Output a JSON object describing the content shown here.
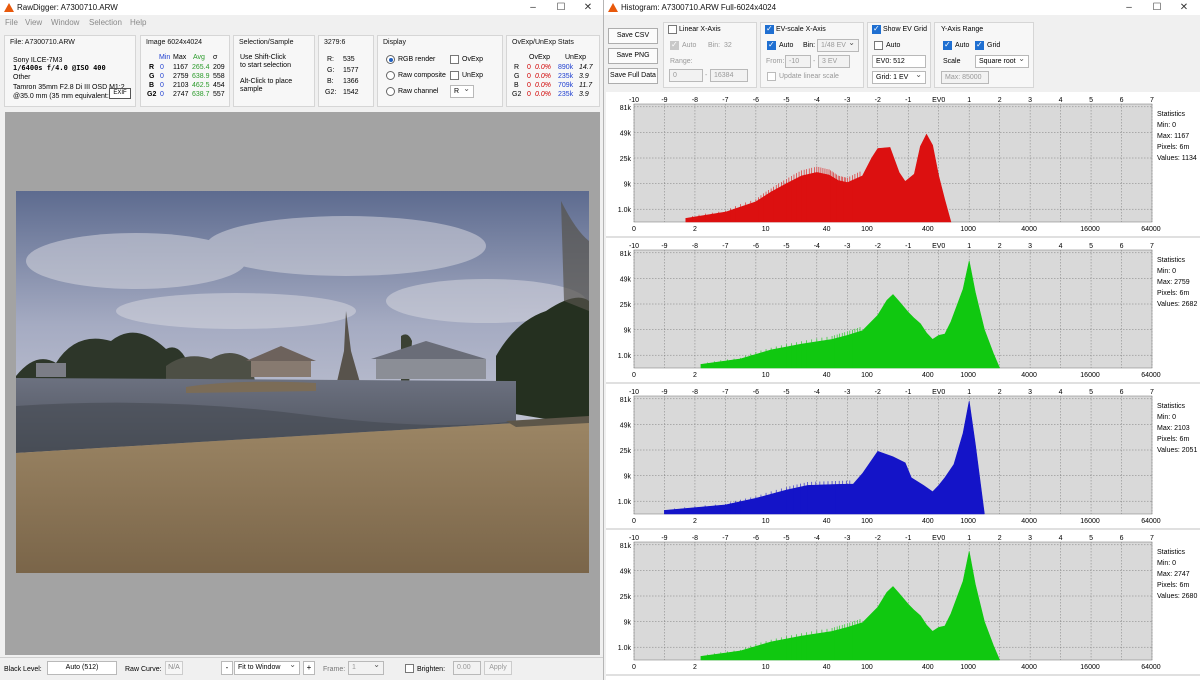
{
  "left": {
    "title": "RawDigger: A7300710.ARW",
    "menu": [
      "File",
      "View",
      "Window",
      "Selection",
      "Help"
    ],
    "file_panel": {
      "title": "File: A7300710.ARW",
      "camera": "Sony ILCE-7M3",
      "exposure": "1/6400s f/4.0 @ISO 400",
      "other": "Other",
      "lens": "Tamron 35mm F2.8 Di III OSD M1:2",
      "focal": "@35.0 mm (35 mm equivalent:",
      "exif_button": "EXIF"
    },
    "image_panel": {
      "title": "Image 6024x4024",
      "headers": [
        "Min",
        "Max",
        "Avg",
        "σ"
      ],
      "rows": [
        {
          "ch": "R",
          "min": "0",
          "max": "1167",
          "avg": "265.4",
          "sd": "209"
        },
        {
          "ch": "G",
          "min": "0",
          "max": "2759",
          "avg": "638.9",
          "sd": "558"
        },
        {
          "ch": "B",
          "min": "0",
          "max": "2103",
          "avg": "462.5",
          "sd": "454"
        },
        {
          "ch": "G2",
          "min": "0",
          "max": "2747",
          "avg": "638.7",
          "sd": "557"
        }
      ]
    },
    "selection_panel": {
      "title": "Selection/Sample",
      "line1": "Use Shift-Click",
      "line2": "to start selection",
      "line3": "Alt-Click to place",
      "line4": "sample"
    },
    "coord_panel": {
      "title": "3279:6",
      "rows": [
        {
          "k": "R:",
          "v": "535"
        },
        {
          "k": "G:",
          "v": "1577"
        },
        {
          "k": "B:",
          "v": "1366"
        },
        {
          "k": "G2:",
          "v": "1542"
        }
      ]
    },
    "display_panel": {
      "title": "Display",
      "rgb_render": "RGB render",
      "raw_composite": "Raw composite",
      "raw_channel": "Raw channel",
      "ovexp": "OvExp",
      "unexp": "UnExp",
      "channel": "R"
    },
    "stats_panel": {
      "title": "OvExp/UnExp Stats",
      "headers": [
        "OvExp",
        "UnExp"
      ],
      "rows": [
        {
          "ch": "R",
          "ov": "0",
          "ovp": "0.0%",
          "un": "890k",
          "unp": "14.7"
        },
        {
          "ch": "G",
          "ov": "0",
          "ovp": "0.0%",
          "un": "235k",
          "unp": "3.9"
        },
        {
          "ch": "B",
          "ov": "0",
          "ovp": "0.0%",
          "un": "709k",
          "unp": "11.7"
        },
        {
          "ch": "G2",
          "ov": "0",
          "ovp": "0.0%",
          "un": "235k",
          "unp": "3.9"
        }
      ]
    },
    "statusbar": {
      "black_level_label": "Black Level:",
      "black_level_value": "Auto (512)",
      "raw_curve_label": "Raw Curve:",
      "raw_curve_value": "N/A",
      "minus": "-",
      "zoom": "Fit to Window",
      "plus": "+",
      "frame_label": "Frame:",
      "frame_value": "1",
      "brighten_label": "Brighten:",
      "brighten_value": "0.00",
      "apply": "Apply"
    }
  },
  "right": {
    "title": "Histogram: A7300710.ARW Full-6024x4024",
    "buttons": {
      "save_csv": "Save CSV",
      "save_png": "Save PNG",
      "save_full": "Save Full Data"
    },
    "linear": {
      "title": "Linear X-Axis",
      "auto": "Auto",
      "bin_label": "Bin:",
      "bin_value": "32",
      "range_label": "Range:",
      "range_from": "0",
      "range_to": "16384"
    },
    "evscale": {
      "title": "EV-scale X-Axis",
      "auto": "Auto",
      "bin_label": "Bin:",
      "bin_value": "1/48 EV",
      "from_label": "From:",
      "from_value": "-10",
      "to_value": "3 EV",
      "update": "Update linear scale"
    },
    "evgrid": {
      "title": "Show EV Grid",
      "auto": "Auto",
      "ev0": "EV0: 512",
      "grid": "Grid: 1 EV"
    },
    "yaxis": {
      "title": "Y-Axis Range",
      "auto": "Auto",
      "grid": "Grid",
      "scale_label": "Scale",
      "scale_value": "Square root",
      "max": "Max: 85000"
    },
    "colors": {
      "R": "#dc1010",
      "G": "#10c810",
      "B": "#1414c8",
      "G2": "#10c810"
    },
    "axis": {
      "ev_ticks": [
        "-10",
        "-9",
        "-8",
        "-7",
        "-6",
        "-5",
        "-4",
        "-3",
        "-2",
        "-1",
        "EV0",
        "1",
        "2",
        "3",
        "4",
        "5",
        "6",
        "7"
      ],
      "lin_ticks": [
        "0",
        "2",
        "10",
        "40",
        "100",
        "400",
        "1000",
        "4000",
        "16000",
        "64000"
      ],
      "y_ticks": [
        "81k",
        "49k",
        "25k",
        "9k",
        "1.0k"
      ]
    }
  },
  "chart_data": [
    {
      "type": "area",
      "channel": "R",
      "x_scale": "EV",
      "xlim": [
        -10,
        7
      ],
      "y_scale": "sqrt",
      "ylim": [
        0,
        85000
      ],
      "grid": true,
      "x": [
        -8.3,
        -7,
        -6,
        -5.5,
        -5,
        -4.5,
        -4,
        -3.6,
        -3.3,
        -3,
        -2.5,
        -2.2,
        -2,
        -1.6,
        -1.3,
        -1.1,
        -0.8,
        -0.6,
        -0.4,
        -0.2,
        0,
        0.2,
        0.4
      ],
      "y": [
        80,
        600,
        2500,
        5500,
        9000,
        13000,
        15000,
        13500,
        10500,
        9500,
        13000,
        25000,
        33000,
        34000,
        15000,
        10000,
        14000,
        35000,
        47000,
        36000,
        13000,
        3000,
        0
      ],
      "stats": {
        "title": "Statistics",
        "min": "Min: 0",
        "max": "Max: 1167",
        "pixels": "Pixels: 6m",
        "values": "Values: 1134"
      }
    },
    {
      "type": "area",
      "channel": "G",
      "x_scale": "EV",
      "xlim": [
        -10,
        7
      ],
      "y_scale": "sqrt",
      "ylim": [
        0,
        85000
      ],
      "grid": true,
      "x": [
        -7.8,
        -6.5,
        -5.5,
        -4.5,
        -3.5,
        -3,
        -2.5,
        -2,
        -1.7,
        -1.5,
        -1.3,
        -1,
        -0.8,
        -0.6,
        -0.4,
        -0.2,
        0,
        0.2,
        0.4,
        0.8,
        1,
        1.2,
        1.5,
        1.8,
        2
      ],
      "y": [
        80,
        500,
        2000,
        3500,
        5000,
        6500,
        8500,
        17000,
        28000,
        33000,
        27000,
        19000,
        15000,
        12000,
        7500,
        5000,
        6500,
        7000,
        13000,
        38000,
        70000,
        35000,
        9000,
        1200,
        0
      ],
      "stats": {
        "title": "Statistics",
        "min": "Min: 0",
        "max": "Max: 2759",
        "pixels": "Pixels: 6m",
        "values": "Values: 2682"
      }
    },
    {
      "type": "area",
      "channel": "B",
      "x_scale": "EV",
      "xlim": [
        -10,
        7
      ],
      "y_scale": "sqrt",
      "ylim": [
        0,
        85000
      ],
      "grid": true,
      "x": [
        -9,
        -7,
        -6,
        -5,
        -4.3,
        -3.5,
        -2.8,
        -2.5,
        -2,
        -1.5,
        -1.1,
        -0.9,
        -0.5,
        -0.2,
        0,
        0.2,
        0.5,
        0.8,
        1,
        1.2,
        1.5
      ],
      "y": [
        80,
        500,
        1500,
        3500,
        5000,
        5300,
        5500,
        10000,
        24000,
        20000,
        16000,
        8000,
        5000,
        3000,
        5000,
        8000,
        15000,
        40000,
        78000,
        30000,
        0
      ],
      "stats": {
        "title": "Statistics",
        "min": "Min: 0",
        "max": "Max: 2103",
        "pixels": "Pixels: 6m",
        "values": "Values: 2051"
      }
    },
    {
      "type": "area",
      "channel": "G2",
      "x_scale": "EV",
      "xlim": [
        -10,
        7
      ],
      "y_scale": "sqrt",
      "ylim": [
        0,
        85000
      ],
      "grid": true,
      "x": [
        -7.8,
        -6.5,
        -5.5,
        -4.5,
        -3.5,
        -3,
        -2.5,
        -2,
        -1.7,
        -1.5,
        -1.3,
        -1,
        -0.8,
        -0.6,
        -0.4,
        -0.2,
        0,
        0.2,
        0.4,
        0.8,
        1,
        1.2,
        1.5,
        1.8,
        2
      ],
      "y": [
        80,
        500,
        2000,
        3500,
        5000,
        6500,
        8500,
        17000,
        28000,
        33000,
        27000,
        19000,
        15000,
        12000,
        7500,
        5000,
        6500,
        7000,
        13000,
        38000,
        72000,
        35000,
        9000,
        1200,
        0
      ],
      "stats": {
        "title": "Statistics",
        "min": "Min: 0",
        "max": "Max: 2747",
        "pixels": "Pixels: 6m",
        "values": "Values: 2680"
      }
    }
  ]
}
